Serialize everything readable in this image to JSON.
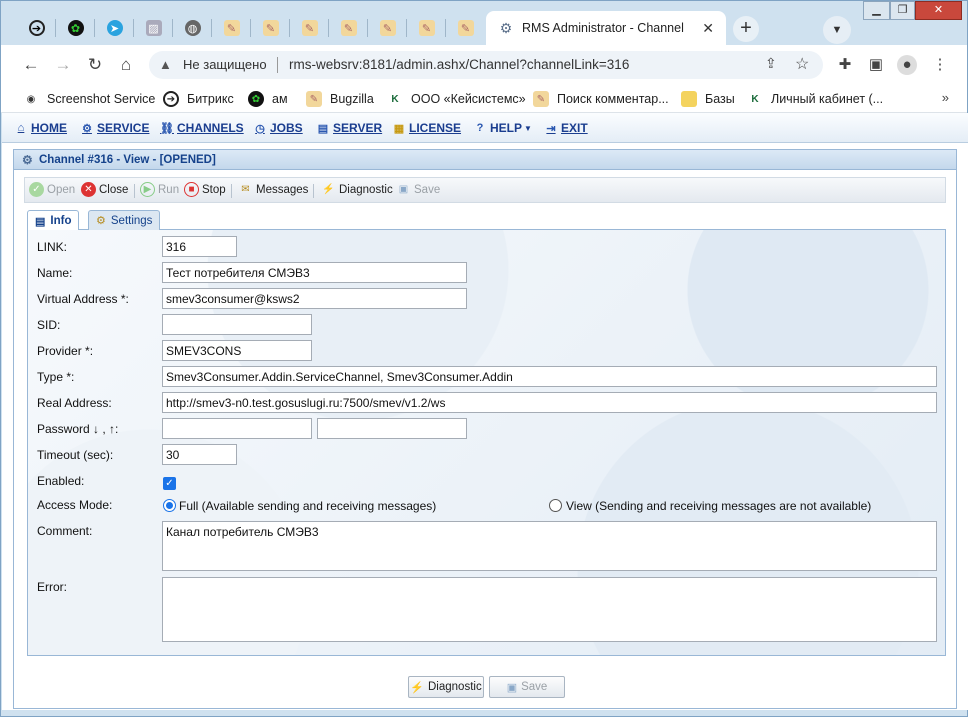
{
  "browser": {
    "tabs": [
      {
        "icon": "arrow-circle-icon"
      },
      {
        "icon": "green-flower-icon"
      },
      {
        "icon": "telegram-icon"
      },
      {
        "icon": "image-icon"
      },
      {
        "icon": "globe-icon"
      },
      {
        "icon": "folder-page-icon"
      },
      {
        "icon": "folder-page-icon"
      },
      {
        "icon": "folder-page-icon"
      },
      {
        "icon": "folder-page-icon"
      },
      {
        "icon": "folder-page-icon"
      },
      {
        "icon": "folder-page-icon"
      },
      {
        "icon": "folder-page-icon"
      }
    ],
    "active_tab_title": "RMS Administrator - Channel",
    "security_label": "Не защищено",
    "url": "rms-websrv:8181/admin.ashx/Channel?channelLink=316",
    "bookmarks": [
      {
        "label": "Screenshot Service",
        "icon": "eye-icon"
      },
      {
        "label": "Битрикс",
        "icon": "arrow-circle-icon"
      },
      {
        "label": "ам",
        "icon": "green-flower-icon"
      },
      {
        "label": "Bugzilla",
        "icon": "folder-page-icon"
      },
      {
        "label": "ООО «Кейсистемс»",
        "icon": "k-logo-icon"
      },
      {
        "label": "Поиск комментар...",
        "icon": "folder-page-icon"
      },
      {
        "label": "Базы",
        "icon": "folder-icon"
      },
      {
        "label": "Личный кабинет (...",
        "icon": "k-logo-icon"
      }
    ],
    "bookmarks_more": "»"
  },
  "menu": {
    "home": "HOME",
    "service": "SERVICE",
    "channels": "CHANNELS",
    "jobs": "JOBS",
    "server": "SERVER",
    "license": "LICENSE",
    "help": "HELP",
    "exit": "EXIT"
  },
  "panel": {
    "title": "Channel #316 - View - [OPENED]",
    "actions": {
      "open": "Open",
      "close": "Close",
      "run": "Run",
      "stop": "Stop",
      "messages": "Messages",
      "diagnostic": "Diagnostic",
      "save": "Save"
    },
    "tabs": {
      "info": "Info",
      "settings": "Settings"
    }
  },
  "form": {
    "link": {
      "label": "LINK:",
      "value": "316"
    },
    "name": {
      "label": "Name:",
      "value": "Тест потребителя СМЭВ3"
    },
    "virtual_address": {
      "label": "Virtual Address *:",
      "value": "smev3consumer@ksws2"
    },
    "sid": {
      "label": "SID:",
      "value": ""
    },
    "provider": {
      "label": "Provider *:",
      "value": "SMEV3CONS"
    },
    "type": {
      "label": "Type *:",
      "value": "Smev3Consumer.Addin.ServiceChannel, Smev3Consumer.Addin"
    },
    "real_address": {
      "label": "Real Address:",
      "value": "http://smev3-n0.test.gosuslugi.ru:7500/smev/v1.2/ws"
    },
    "password": {
      "label": "Password ↓ , ↑:",
      "value_down": "",
      "value_up": ""
    },
    "timeout": {
      "label": "Timeout (sec):",
      "value": "30"
    },
    "enabled": {
      "label": "Enabled:",
      "checked": true
    },
    "access_mode": {
      "label": "Access Mode:",
      "full": "Full (Available sending and receiving messages)",
      "view": "View (Sending and receiving messages are not available)",
      "selected": "full"
    },
    "comment": {
      "label": "Comment:",
      "value": "Канал потребитель СМЭВ3"
    },
    "error": {
      "label": "Error:",
      "value": ""
    }
  },
  "footer_buttons": {
    "diagnostic": "Diagnostic",
    "save": "Save"
  }
}
